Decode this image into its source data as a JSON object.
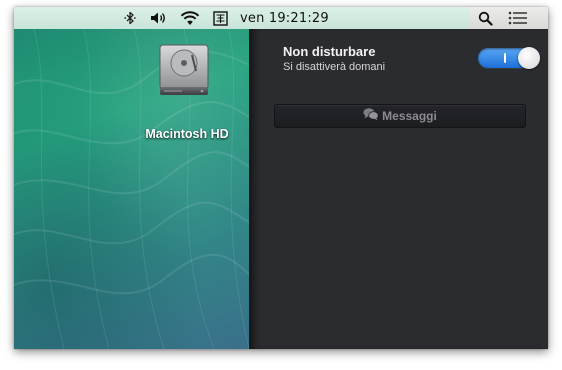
{
  "menubar": {
    "clock": "ven 19:21:29",
    "icons": [
      "bluetooth-icon",
      "volume-icon",
      "wifi-icon",
      "input-menu-icon",
      "spotlight-search-icon",
      "notification-center-icon"
    ]
  },
  "desktop": {
    "drive_label": "Macintosh HD"
  },
  "notification_center": {
    "dnd_title": "Non disturbare",
    "dnd_subtitle": "Si disattiverà domani",
    "dnd_enabled": true,
    "sections": [
      {
        "label": "Messaggi",
        "icon": "messages-icon"
      }
    ]
  },
  "colors": {
    "toggle_on": "#2f86ea",
    "panel_bg": "#2b2c30",
    "menubar_bg": "#e3e4e0"
  }
}
